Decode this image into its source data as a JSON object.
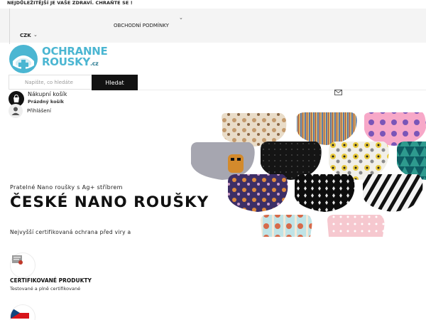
{
  "topbar": {
    "message": "NEJDŮLEŽITĚJŠÍ JE VAŠE ZDRAVÍ. CHRAŇTE SE !"
  },
  "nav": {
    "terms_label": "OBCHODNÍ PODMÍNKY",
    "currency": "CZK"
  },
  "logo": {
    "line1": "OCHRANNE",
    "line2": "ROUSKY",
    "tld": ".cz"
  },
  "search": {
    "placeholder": "Napište, co hledáte",
    "button_label": "Hledat"
  },
  "cart": {
    "title": "Nákupní košík",
    "status": "Prázdný košík"
  },
  "account": {
    "login_label": "Přihlášení"
  },
  "hero": {
    "kicker": "Pratelné Nano roušky s Ag+ stříbrem",
    "title": "ČESKÉ NANO ROUŠKY",
    "subtitle": "Nejvyšší certifikovaná ochrana před viry a"
  },
  "features": [
    {
      "title": "CERTIFIKOVANÉ PRODUKTY",
      "subtitle": "Testované a plně certifikované"
    }
  ],
  "colors": {
    "accent": "#4bb6d2",
    "dark": "#121212",
    "header_bg": "#f4f4f4"
  },
  "icons": [
    "chevron-down-icon",
    "logo-icon",
    "mail-icon",
    "cart-icon",
    "user-icon",
    "certificate-icon",
    "czech-flag-icon"
  ]
}
